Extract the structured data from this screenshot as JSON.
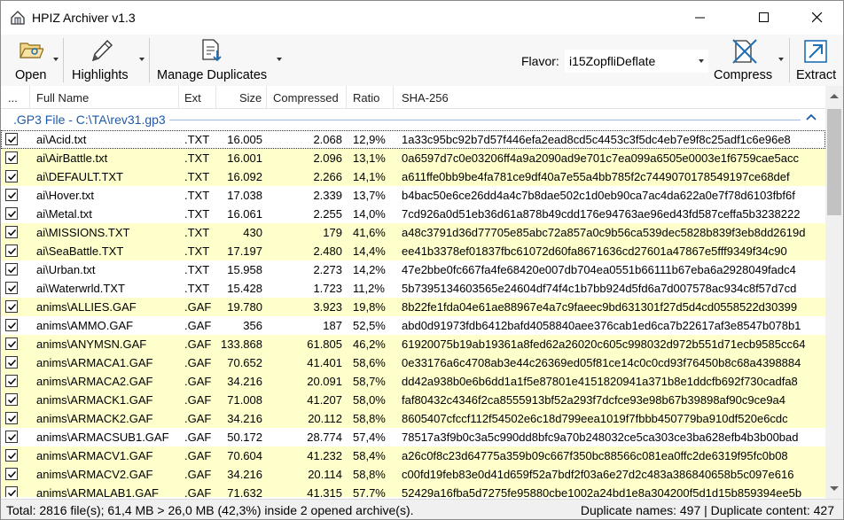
{
  "window": {
    "title": "HPIZ Archiver v1.3"
  },
  "toolbar": {
    "open_label": "Open",
    "highlights_label": "Highlights",
    "manage_duplicates_label": "Manage Duplicates",
    "flavor_label": "Flavor:",
    "flavor_value": "i15ZopfliDeflate",
    "compress_label": "Compress",
    "extract_label": "Extract"
  },
  "columns": {
    "dots": "...",
    "full_name": "Full Name",
    "ext": "Ext",
    "size": "Size",
    "compressed": "Compressed",
    "ratio": "Ratio",
    "sha": "SHA-256"
  },
  "group": {
    "label": ".GP3 File - C:\\TA\\rev31.gp3"
  },
  "rows": [
    {
      "name": "ai\\Acid.txt",
      "ext": ".TXT",
      "size": "16.005",
      "comp": "2.068",
      "ratio": "12,9%",
      "sha": "1a33c95bc92b7d57f446efa2ead8cd5c4453c3f5dc4eb7e9f8c25adf1c6e96e8",
      "hl": false
    },
    {
      "name": "ai\\AirBattle.txt",
      "ext": ".TXT",
      "size": "16.001",
      "comp": "2.096",
      "ratio": "13,1%",
      "sha": "0a6597d7c0e03206ff4a9a2090ad9e701c7ea099a6505e0003e1f6759cae5acc",
      "hl": true
    },
    {
      "name": "ai\\DEFAULT.TXT",
      "ext": ".TXT",
      "size": "16.092",
      "comp": "2.266",
      "ratio": "14,1%",
      "sha": "a611ffe0bb9be4fa781ce9df40a7e55a4bb785f2c7449070178549197ce68def",
      "hl": true
    },
    {
      "name": "ai\\Hover.txt",
      "ext": ".TXT",
      "size": "17.038",
      "comp": "2.339",
      "ratio": "13,7%",
      "sha": "b4bac50e6ce26dd4a4c7b8dae502c1d0eb90ca7ac4da622a0e7f78d6103fbf6f",
      "hl": false
    },
    {
      "name": "ai\\Metal.txt",
      "ext": ".TXT",
      "size": "16.061",
      "comp": "2.255",
      "ratio": "14,0%",
      "sha": "7cd926a0d51eb36d61a878b49cdd176e94763ae96ed43fd587ceffa5b3238222",
      "hl": false
    },
    {
      "name": "ai\\MISSIONS.TXT",
      "ext": ".TXT",
      "size": "430",
      "comp": "179",
      "ratio": "41,6%",
      "sha": "a48c3791d36d77705e85abc72a857a0c9b56ca539dec5828b839f3eb8dd2619d",
      "hl": true
    },
    {
      "name": "ai\\SeaBattle.TXT",
      "ext": ".TXT",
      "size": "17.197",
      "comp": "2.480",
      "ratio": "14,4%",
      "sha": "ee41b3378ef01837fbc61072d60fa8671636cd27601a47867e5fff9349f34c90",
      "hl": true
    },
    {
      "name": "ai\\Urban.txt",
      "ext": ".TXT",
      "size": "15.958",
      "comp": "2.273",
      "ratio": "14,2%",
      "sha": "47e2bbe0fc667fa4fe68420e007db704ea0551b66111b67eba6a2928049fadc4",
      "hl": false
    },
    {
      "name": "ai\\Waterwrld.TXT",
      "ext": ".TXT",
      "size": "15.428",
      "comp": "1.723",
      "ratio": "11,2%",
      "sha": "5b7395134603565e24604df74f4c1b7bb924d5fd6a7d007578ac934c8f57d7cd",
      "hl": false
    },
    {
      "name": "anims\\ALLIES.GAF",
      "ext": ".GAF",
      "size": "19.780",
      "comp": "3.923",
      "ratio": "19,8%",
      "sha": "8b22fe1fda04e61ae88967e4a7c9faeec9bd631301f27d5d4cd0558522d30399",
      "hl": true
    },
    {
      "name": "anims\\AMMO.GAF",
      "ext": ".GAF",
      "size": "356",
      "comp": "187",
      "ratio": "52,5%",
      "sha": "abd0d91973fdb6412bafd4058840aee376cab1ed6ca7b22617af3e8547b078b1",
      "hl": false
    },
    {
      "name": "anims\\ANYMSN.GAF",
      "ext": ".GAF",
      "size": "133.868",
      "comp": "61.805",
      "ratio": "46,2%",
      "sha": "61920075b19ab19361a8fed62a26020c605c998032d972b551d71ecb9585cc64",
      "hl": true
    },
    {
      "name": "anims\\ARMACA1.GAF",
      "ext": ".GAF",
      "size": "70.652",
      "comp": "41.401",
      "ratio": "58,6%",
      "sha": "0e33176a6c4708ab3e44c26369ed05f81ce14c0c0cd93f76450b8c68a4398884",
      "hl": true
    },
    {
      "name": "anims\\ARMACA2.GAF",
      "ext": ".GAF",
      "size": "34.216",
      "comp": "20.091",
      "ratio": "58,7%",
      "sha": "dd42a938b0e6b6dd1a1f5e87801e4151820941a371b8e1ddcfb692f730cadfa8",
      "hl": true
    },
    {
      "name": "anims\\ARMACK1.GAF",
      "ext": ".GAF",
      "size": "71.008",
      "comp": "41.207",
      "ratio": "58,0%",
      "sha": "faf80432c4346f2ca8555913bf52a293f7dcfce93e98b67b39898af90c9ce9a4",
      "hl": true
    },
    {
      "name": "anims\\ARMACK2.GAF",
      "ext": ".GAF",
      "size": "34.216",
      "comp": "20.112",
      "ratio": "58,8%",
      "sha": "8605407cfccf112f54502e6c18d799eea1019f7fbbb450779ba910df520e6cdc",
      "hl": true
    },
    {
      "name": "anims\\ARMACSUB1.GAF",
      "ext": ".GAF",
      "size": "50.172",
      "comp": "28.774",
      "ratio": "57,4%",
      "sha": "78517a3f9b0c3a5c990dd8bfc9a70b248032ce5ca303ce3ba628efb4b3b00bad",
      "hl": false
    },
    {
      "name": "anims\\ARMACV1.GAF",
      "ext": ".GAF",
      "size": "70.604",
      "comp": "41.232",
      "ratio": "58,4%",
      "sha": "a26c0f8c23d64775a359b09c667f350bc88566c081ea0ffc2de6319f95fc0b08",
      "hl": true
    },
    {
      "name": "anims\\ARMACV2.GAF",
      "ext": ".GAF",
      "size": "34.216",
      "comp": "20.114",
      "ratio": "58,8%",
      "sha": "c00fd19feb83e0d41d659f52a7bdf2f03a6e27d2c483a386840658b5c097e616",
      "hl": true
    },
    {
      "name": "anims\\ARMALAB1.GAF",
      "ext": ".GAF",
      "size": "71.632",
      "comp": "41.315",
      "ratio": "57,7%",
      "sha": "52429a16fba5d7275fe95880cbe1002a24bd1e8a304200f5d1d15b859394ee5b",
      "hl": true
    }
  ],
  "status": {
    "left": "Total: 2816 file(s); 61,4 MB > 26,0 MB (42,3%) inside 2 opened archive(s).",
    "right": "Duplicate names: 497 | Duplicate content: 427"
  },
  "colors": {
    "highlight_row": "#ffffcc",
    "group_text": "#1e5aa8",
    "accent": "#1f6fb5"
  }
}
